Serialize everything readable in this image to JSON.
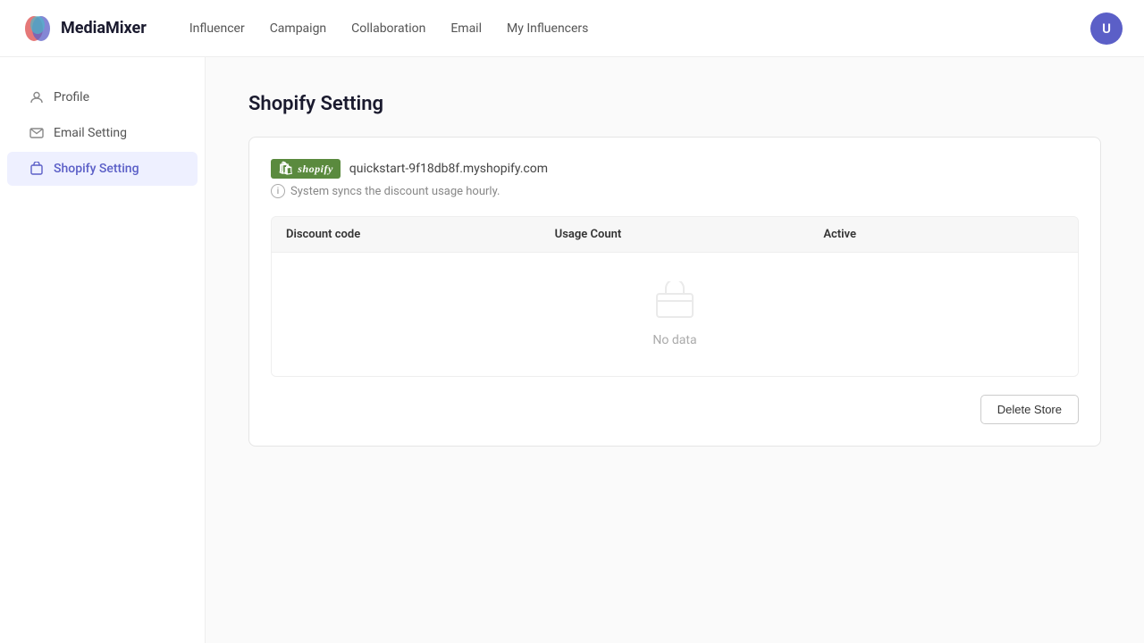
{
  "app": {
    "logo_text": "MediaMixer",
    "user_initial": "U"
  },
  "nav": {
    "links": [
      {
        "label": "Influencer",
        "id": "influencer"
      },
      {
        "label": "Campaign",
        "id": "campaign"
      },
      {
        "label": "Collaboration",
        "id": "collaboration"
      },
      {
        "label": "Email",
        "id": "email"
      },
      {
        "label": "My Influencers",
        "id": "my-influencers"
      }
    ]
  },
  "sidebar": {
    "items": [
      {
        "label": "Profile",
        "id": "profile",
        "active": false
      },
      {
        "label": "Email Setting",
        "id": "email-setting",
        "active": false
      },
      {
        "label": "Shopify Setting",
        "id": "shopify-setting",
        "active": true
      }
    ]
  },
  "page": {
    "title": "Shopify Setting"
  },
  "shopify_card": {
    "store_label": "shopify",
    "store_url": "quickstart-9f18db8f.myshopify.com",
    "sync_note": "System syncs the discount usage hourly.",
    "table": {
      "columns": [
        "Discount code",
        "Usage Count",
        "Active"
      ],
      "empty_text": "No data"
    },
    "delete_button": "Delete Store"
  }
}
